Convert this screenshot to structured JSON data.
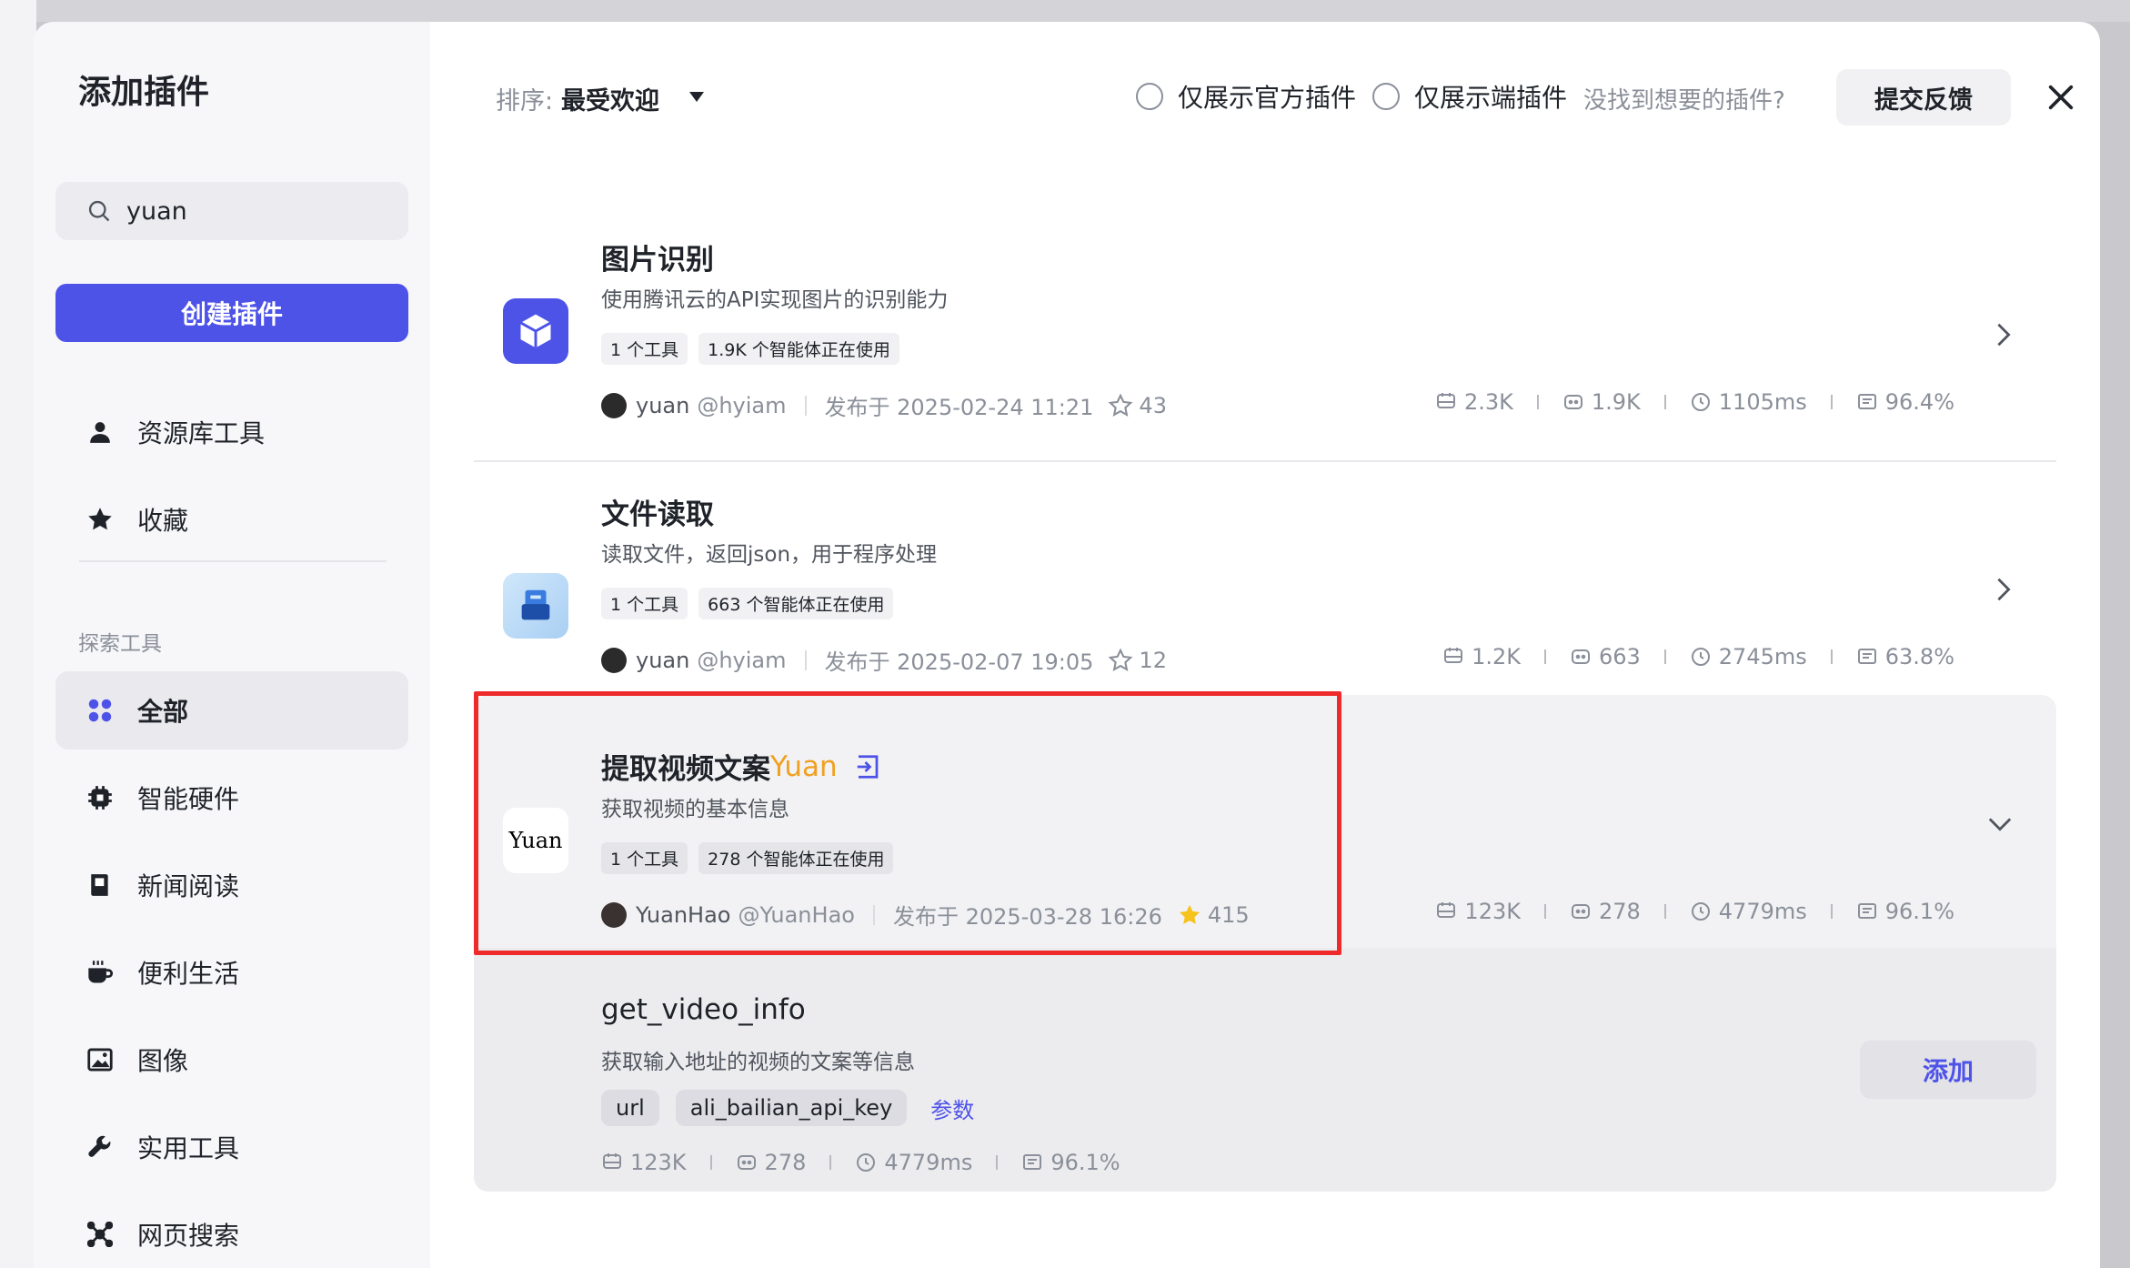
{
  "sidebar": {
    "title": "添加插件",
    "search": {
      "value": "yuan",
      "placeholder": ""
    },
    "create_label": "创建插件",
    "items_top": [
      {
        "label": "资源库工具",
        "icon": "user-icon"
      },
      {
        "label": "收藏",
        "icon": "star-icon"
      }
    ],
    "section_label": "探索工具",
    "items": [
      {
        "label": "全部",
        "icon": "grid-icon",
        "active": true
      },
      {
        "label": "智能硬件",
        "icon": "chip-icon"
      },
      {
        "label": "新闻阅读",
        "icon": "newspaper-icon"
      },
      {
        "label": "便利生活",
        "icon": "coffee-icon"
      },
      {
        "label": "图像",
        "icon": "image-icon"
      },
      {
        "label": "实用工具",
        "icon": "wrench-icon"
      },
      {
        "label": "网页搜索",
        "icon": "network-icon"
      }
    ]
  },
  "topbar": {
    "sort_label": "排序:",
    "sort_value": "最受欢迎",
    "filter_official": "仅展示官方插件",
    "filter_client": "仅展示端插件",
    "not_found": "没找到想要的插件?",
    "feedback_label": "提交反馈"
  },
  "plugins": [
    {
      "name": "图片识别",
      "desc": "使用腾讯云的API实现图片的识别能力",
      "tag_tools": "1 个工具",
      "tag_usage": "1.9K 个智能体正在使用",
      "author": "yuan",
      "handle": "@hyiam",
      "published": "发布于 2025-02-24 11:21",
      "stars": "43",
      "stat_calls": "2.3K",
      "stat_bots": "1.9K",
      "stat_latency": "1105ms",
      "stat_success": "96.4%"
    },
    {
      "name": "文件读取",
      "desc": "读取文件，返回json，用于程序处理",
      "tag_tools": "1 个工具",
      "tag_usage": "663 个智能体正在使用",
      "author": "yuan",
      "handle": "@hyiam",
      "published": "发布于 2025-02-07 19:05",
      "stars": "12",
      "stat_calls": "1.2K",
      "stat_bots": "663",
      "stat_latency": "2745ms",
      "stat_success": "63.8%"
    },
    {
      "name": "提取视频文案",
      "name_highlight": "Yuan",
      "logo_text": "Yuan",
      "desc": "获取视频的基本信息",
      "tag_tools": "1 个工具",
      "tag_usage": "278 个智能体正在使用",
      "author": "YuanHao",
      "handle": "@YuanHao",
      "published": "发布于 2025-03-28 16:26",
      "stars": "415",
      "stat_calls": "123K",
      "stat_bots": "278",
      "stat_latency": "4779ms",
      "stat_success": "96.1%"
    }
  ],
  "tool": {
    "name": "get_video_info",
    "desc": "获取输入地址的视频的文案等信息",
    "params": [
      "url",
      "ali_bailian_api_key"
    ],
    "params_link": "参数",
    "stat_calls": "123K",
    "stat_bots": "278",
    "stat_latency": "4779ms",
    "stat_success": "96.1%",
    "add_label": "添加"
  },
  "colors": {
    "accent": "#4e53e8",
    "highlight_name": "#f0a020",
    "red_box": "#ee2a2a"
  }
}
